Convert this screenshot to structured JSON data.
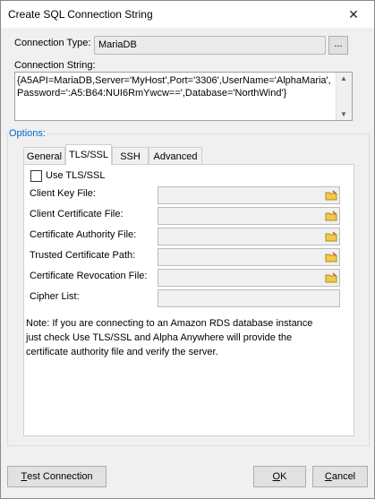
{
  "window": {
    "title": "Create SQL Connection String",
    "close_glyph": "✕"
  },
  "connection_type": {
    "label": "Connection Type:",
    "value": "MariaDB",
    "browse_label": "..."
  },
  "connection_string": {
    "label": "Connection String:",
    "line1": "{A5API=MariaDB,Server='MyHost',Port='3306',UserName='AlphaMaria',",
    "line2": "Password=':A5:B64:NUI6RmYwcw==',Database='NorthWind'}"
  },
  "options": {
    "label": "Options:"
  },
  "tabs": [
    {
      "label": "General",
      "active": false
    },
    {
      "label": "TLS/SSL",
      "active": true
    },
    {
      "label": "SSH",
      "active": false
    },
    {
      "label": "Advanced",
      "active": false
    }
  ],
  "tls": {
    "use_label": "Use TLS/SSL",
    "use_checked": false,
    "fields": [
      {
        "label": "Client Key File:",
        "value": "",
        "has_browse": true
      },
      {
        "label": "Client Certificate File:",
        "value": "",
        "has_browse": true
      },
      {
        "label": "Certificate Authority File:",
        "value": "",
        "has_browse": true
      },
      {
        "label": "Trusted Certificate Path:",
        "value": "",
        "has_browse": true
      },
      {
        "label": "Certificate Revocation File:",
        "value": "",
        "has_browse": true
      },
      {
        "label": "Cipher List:",
        "value": "",
        "has_browse": false
      }
    ],
    "note_lines": [
      "Note:  If you are connecting to an Amazon RDS database instance",
      "just check Use TLS/SSL and Alpha Anywhere will provide the",
      "certificate authority file and verify the server."
    ]
  },
  "buttons": {
    "test_first": "T",
    "test_rest": "est Connection",
    "ok_first": "O",
    "ok_rest": "K",
    "cancel_first": "C",
    "cancel_rest": "ancel"
  },
  "icons": {
    "browse_folder": "folder-icon",
    "close": "close-icon"
  },
  "colors": {
    "options_label": "#0066cc",
    "window_bg": "#f0f0f0"
  }
}
